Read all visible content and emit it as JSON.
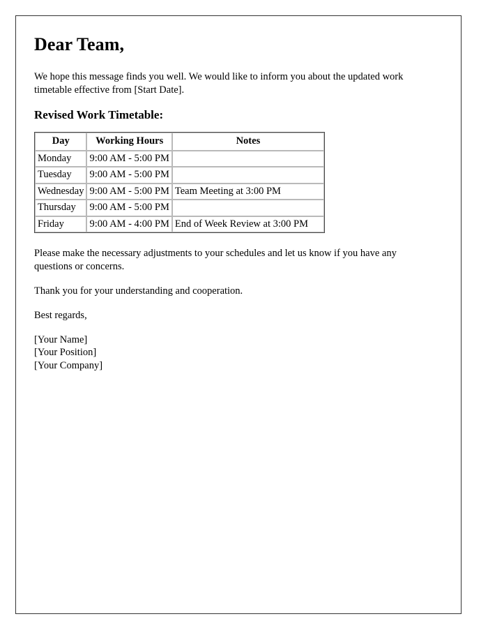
{
  "document": {
    "salutation": "Dear Team,",
    "intro_paragraph": "We hope this message finds you well. We would like to inform you about the updated work timetable effective from [Start Date].",
    "section_heading": "Revised Work Timetable:",
    "closing_paragraph_1": "Please make the necessary adjustments to your schedules and let us know if you have any questions or concerns.",
    "closing_paragraph_2": "Thank you for your understanding and cooperation.",
    "sign_off": "Best regards,",
    "signature": {
      "name": "[Your Name]",
      "position": "[Your Position]",
      "company": "[Your Company]"
    }
  },
  "timetable": {
    "headers": [
      "Day",
      "Working Hours",
      "Notes"
    ],
    "rows": [
      {
        "day": "Monday",
        "hours": "9:00 AM - 5:00 PM",
        "notes": ""
      },
      {
        "day": "Tuesday",
        "hours": "9:00 AM - 5:00 PM",
        "notes": ""
      },
      {
        "day": "Wednesday",
        "hours": "9:00 AM - 5:00 PM",
        "notes": "Team Meeting at 3:00 PM"
      },
      {
        "day": "Thursday",
        "hours": "9:00 AM - 5:00 PM",
        "notes": ""
      },
      {
        "day": "Friday",
        "hours": "9:00 AM - 4:00 PM",
        "notes": "End of Week Review at 3:00 PM"
      }
    ]
  },
  "colors": {
    "page_border": "#333333",
    "table_outer_border": "#4a4a4a",
    "table_cell_border": "#b9b9b9",
    "text": "#000000",
    "background": "#ffffff"
  }
}
